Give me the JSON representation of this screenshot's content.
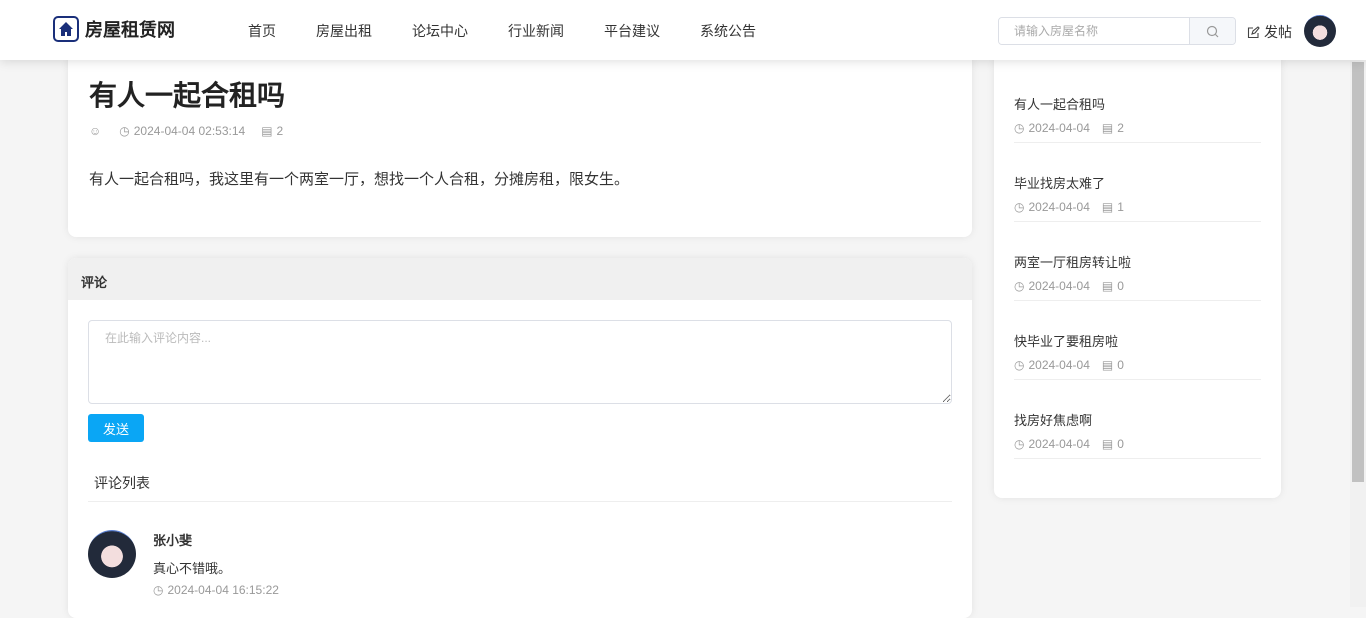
{
  "header": {
    "logo": "房屋租赁网",
    "nav": [
      "首页",
      "房屋出租",
      "论坛中心",
      "行业新闻",
      "平台建议",
      "系统公告"
    ],
    "search_placeholder": "请输入房屋名称",
    "post_label": "发帖"
  },
  "post": {
    "title": "有人一起合租吗",
    "time": "2024-04-04 02:53:14",
    "comments": "2",
    "content": "有人一起合租吗，我这里有一个两室一厅，想找一个人合租，分摊房租，限女生。"
  },
  "comment_section": {
    "header": "评论",
    "placeholder": "在此输入评论内容...",
    "send_label": "发送",
    "list_title": "评论列表",
    "comments": [
      {
        "user": "张小斐",
        "text": "真心不错哦。",
        "time": "2024-04-04 16:15:22"
      }
    ]
  },
  "sidebar": {
    "items": [
      {
        "title": "有人一起合租吗",
        "date": "2024-04-04",
        "comments": "2"
      },
      {
        "title": "毕业找房太难了",
        "date": "2024-04-04",
        "comments": "1"
      },
      {
        "title": "两室一厅租房转让啦",
        "date": "2024-04-04",
        "comments": "0"
      },
      {
        "title": "快毕业了要租房啦",
        "date": "2024-04-04",
        "comments": "0"
      },
      {
        "title": "找房好焦虑啊",
        "date": "2024-04-04",
        "comments": "0"
      }
    ]
  }
}
